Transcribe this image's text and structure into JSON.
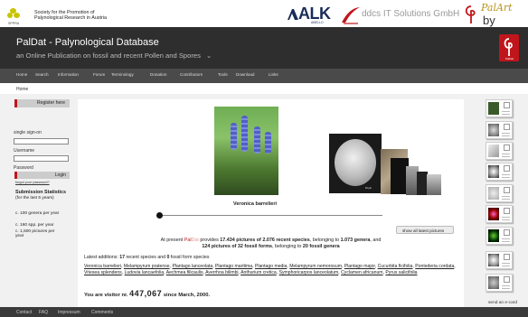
{
  "topbar": {
    "org_line1": "Society for the Promotion of",
    "org_line2": "Palynological Research in Austria",
    "org_abbrev": "SPPRA",
    "sponsor1": "ALK",
    "sponsor1_sub": "ABELLO",
    "sponsor2": "ddcs IT Solutions GmbH",
    "paldat_by": "PalArt",
    "paldat_name": "by PalDat"
  },
  "header": {
    "title": "PalDat - Palynological Database",
    "subtitle": "an Online Publication on fossil and recent Pollen and Spores",
    "badge": "PalDat"
  },
  "nav": [
    "Home",
    "Search",
    "Information",
    "Forum",
    "Terminology",
    "Donation",
    "Contributors",
    "Tools",
    "Download",
    "Links"
  ],
  "breadcrumb": "Home",
  "sidebar": {
    "register_label": "Register here",
    "sso_label": "single sign-on",
    "username_label": "Username",
    "password_label": "Password",
    "login_label": "Login",
    "forgot_label": "forgot your password?",
    "stats_heading": "Submission Statistics",
    "stats_sub": "(for the last 5 years)",
    "stats_items": [
      "c. 100 genera per year",
      "c. 160 spp. per year",
      "c. 1,500 pictures per year"
    ]
  },
  "main": {
    "caption": "Veronica barrelieri",
    "show_all_label": "show all latest pictures",
    "present_pre": "At present ",
    "present_pal": "Pal",
    "present_dat": "Dat",
    "present_mid": " provides ",
    "pictures_recent": "17.434 pictures of 2.076 recent species",
    "present_mid2": ", belonging to ",
    "genera_count": "1.073 genera",
    "present_end": ", and",
    "fossil_pictures": "124 pictures of 32 fossil forms",
    "present_mid3": ", belonging to ",
    "fossil_genera": "20 fossil genera",
    "latest_pre": "Latest additions: ",
    "latest_recent": "17",
    "latest_mid": " recent species and ",
    "latest_fossil": "0",
    "latest_end": " fossil form species",
    "species": [
      "Veronica barrelieri",
      "Melampyrum pratense",
      "Plantago lanceolata",
      "Plantago maritima",
      "Plantago media",
      "Melampyrum nemorosum",
      "Plantago major",
      "Cucurbita ficifolia",
      "Pontederia cordata",
      "Vriesea splendens",
      "Ludovia lancaefolia",
      "Aechmea filicaulis",
      "Averrhoa bilimbi",
      "Anthurium cretica",
      "Symphoricarpos lanceolatum",
      "Cyclamen africanum",
      "Pyrus salicifolia"
    ],
    "visitor_pre": "You are visitor nr. ",
    "visitor_num": "447,067",
    "visitor_post": " since March, 2000."
  },
  "right": {
    "send_ecard": "send an e-card"
  },
  "footer": [
    "Contact",
    "FAQ",
    "Impressum",
    "Comments"
  ]
}
